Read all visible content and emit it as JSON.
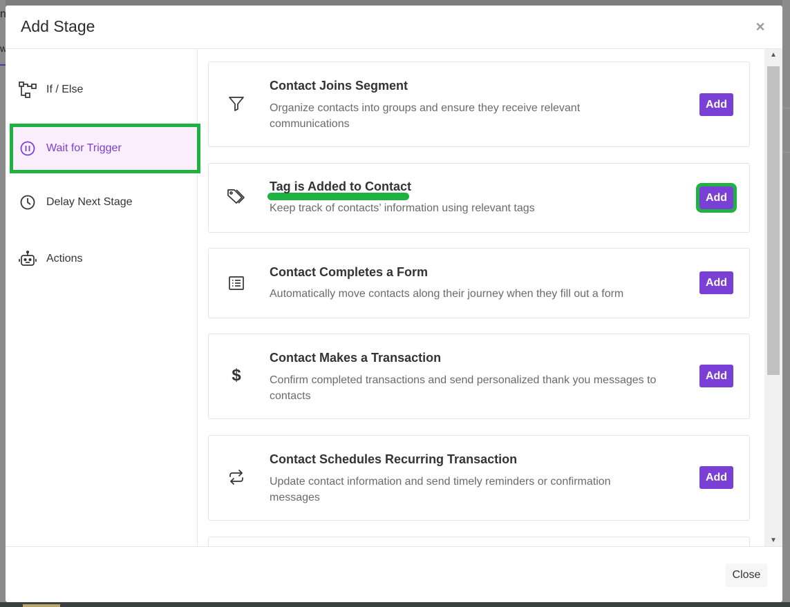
{
  "background": {
    "peek_text_1": "nt",
    "peek_text_2": "w"
  },
  "modal": {
    "title": "Add Stage",
    "close_glyph": "×"
  },
  "sidebar": {
    "items": [
      {
        "label": "If / Else",
        "icon": "branch-icon"
      },
      {
        "label": "Wait for Trigger",
        "icon": "pause-circle-icon",
        "active": true
      },
      {
        "label": "Delay Next Stage",
        "icon": "clock-icon"
      },
      {
        "label": "Actions",
        "icon": "robot-icon"
      }
    ]
  },
  "triggers": [
    {
      "title": "Contact Joins Segment",
      "description": "Organize contacts into groups and ensure they receive relevant communications",
      "icon": "filter-icon",
      "button": "Add"
    },
    {
      "title": "Tag is Added to Contact",
      "description": "Keep track of contacts’ information using relevant tags",
      "icon": "tags-icon",
      "button": "Add"
    },
    {
      "title": "Contact Completes a Form",
      "description": "Automatically move contacts along their journey when they fill out a form",
      "icon": "form-list-icon",
      "button": "Add"
    },
    {
      "title": "Contact Makes a Transaction",
      "description": "Confirm completed transactions and send personalized thank you messages to contacts",
      "icon": "dollar-icon",
      "button": "Add"
    },
    {
      "title": "Contact Schedules Recurring Transaction",
      "description": "Update contact information and send timely reminders or confirmation messages",
      "icon": "repeat-icon",
      "button": "Add"
    }
  ],
  "footer": {
    "close_label": "Close"
  },
  "colors": {
    "accent": "#7a3fd4",
    "highlight": "#1fb142",
    "active_bg": "#fbeefc"
  }
}
